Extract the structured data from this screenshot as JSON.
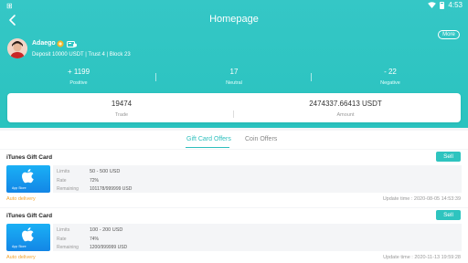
{
  "status": {
    "left_text": "⊞",
    "time": "4:53"
  },
  "header": {
    "title": "Homepage",
    "more_label": "More"
  },
  "user": {
    "name": "Adaego",
    "meta": "Deposit 10000 USDT | Trust 4 | Block 23"
  },
  "ratings": [
    {
      "value": "+ 1199",
      "label": "Positive"
    },
    {
      "value": "17",
      "label": "Neutral"
    },
    {
      "value": "- 22",
      "label": "Negative"
    }
  ],
  "stats": [
    {
      "value": "19474",
      "label": "Trade"
    },
    {
      "value": "2474337.66413 USDT",
      "label": "Amount"
    }
  ],
  "tabs": [
    {
      "label": "Gift Card Offers",
      "active": true
    },
    {
      "label": "Coin Offers",
      "active": false
    }
  ],
  "offers": [
    {
      "title": "iTunes Gift Card",
      "sell_label": "Sell",
      "limits_label": "Limits",
      "limits": "50 - 500 USD",
      "rate_label": "Rate",
      "rate": "72%",
      "remaining_label": "Remaining",
      "remaining": "101178/999999 USD",
      "auto_delivery": "Auto delivery",
      "update_time": "Update time : 2020-08-05 14:53:39",
      "image_label": "App Store"
    },
    {
      "title": "iTunes Gift Card",
      "sell_label": "Sell",
      "limits_label": "Limits",
      "limits": "100 - 200 USD",
      "rate_label": "Rate",
      "rate": "74%",
      "remaining_label": "Remaining",
      "remaining": "1200/999999 USD",
      "auto_delivery": "Auto delivery",
      "update_time": "Update time : 2020-11-13 19:59:28",
      "image_label": "App Store"
    }
  ],
  "colors": {
    "accent": "#2ec4bf",
    "orange": "#f4a32c"
  }
}
